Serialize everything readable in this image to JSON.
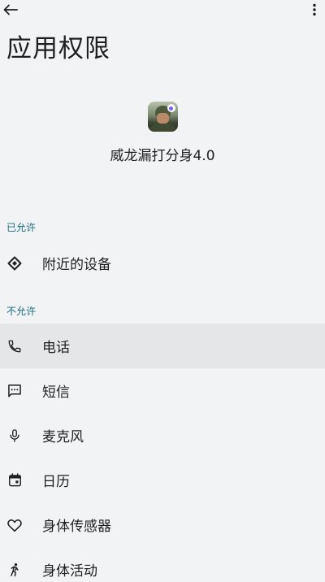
{
  "header": {
    "title": "应用权限"
  },
  "app": {
    "name": "威龙漏打分身4.0"
  },
  "sections": {
    "allowed": {
      "label": "已允许",
      "items": [
        {
          "label": "附近的设备",
          "icon": "nearby-devices-icon"
        }
      ]
    },
    "denied": {
      "label": "不允许",
      "items": [
        {
          "label": "电话",
          "icon": "phone-icon"
        },
        {
          "label": "短信",
          "icon": "sms-icon"
        },
        {
          "label": "麦克风",
          "icon": "microphone-icon"
        },
        {
          "label": "日历",
          "icon": "calendar-icon"
        },
        {
          "label": "身体传感器",
          "icon": "heart-icon"
        },
        {
          "label": "身体活动",
          "icon": "running-icon"
        }
      ]
    }
  },
  "colors": {
    "background": "#f1f3f4",
    "accent": "#1a6b7a",
    "highlight": "#e4e6e7"
  }
}
